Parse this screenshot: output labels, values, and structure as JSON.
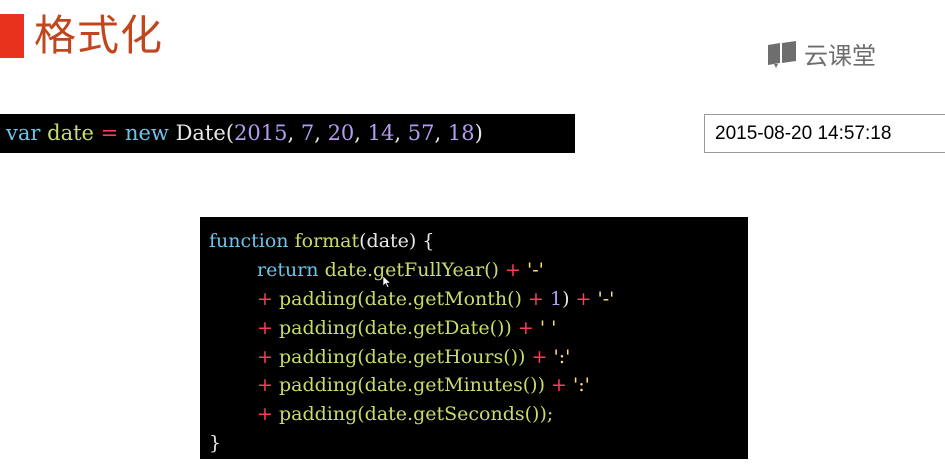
{
  "slide": {
    "title": "格式化",
    "accent_color": "#e8321e",
    "title_color": "#c0461e"
  },
  "brand": {
    "logo_icon": "book-logo-icon",
    "name": "云课堂"
  },
  "top_code": {
    "kw_var": "var",
    "ident_date": "date",
    "op_eq": "=",
    "kw_new": "new",
    "ctor": "Date",
    "open": "(",
    "args": [
      "2015",
      "7",
      "20",
      "14",
      "57",
      "18"
    ],
    "sep": ", ",
    "close": ")"
  },
  "output": {
    "value": "2015-08-20 14:57:18"
  },
  "code_block": {
    "l1": {
      "kw": "function",
      "name": "format",
      "params": "(date) {"
    },
    "l2": {
      "kw": "return",
      "expr": "date.getFullYear()",
      "op": "+",
      "str": "'-'"
    },
    "l3": {
      "op": "+",
      "call_a": "padding(date.getMonth()",
      "op2": "+",
      "num": "1",
      "close": ")",
      "op3": "+",
      "str": "'-'"
    },
    "l4": {
      "op": "+",
      "call": "padding(date.getDate())",
      "op2": "+",
      "str": "' '"
    },
    "l5": {
      "op": "+",
      "call": "padding(date.getHours())",
      "op2": "+",
      "str": "':'"
    },
    "l6": {
      "op": "+",
      "call": "padding(date.getMinutes())",
      "op2": "+",
      "str": "':'"
    },
    "l7": {
      "op": "+",
      "call": "padding(date.getSeconds());"
    },
    "l8": {
      "text": "}"
    }
  },
  "colors": {
    "keyword": "#6ec3e8",
    "identifier": "#c8dc6a",
    "operator": "#ff3b5c",
    "number": "#b49cf0",
    "string": "#ffe27a"
  }
}
